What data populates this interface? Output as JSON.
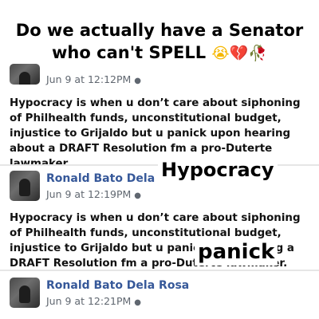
{
  "headline": {
    "line1": "Do we actually have a Senator",
    "line2": "who can't SPELL",
    "emojis": [
      "😭",
      "💔",
      "🥀"
    ]
  },
  "posts": [
    {
      "timestamp": "Jun 9 at 12:12PM",
      "text": "Hypocracy is when u don’t care about siphoning of Philhealth funds, unconstitutional budget, injustice to Grijaldo but u panick upon hearing about a DRAFT Resolution fm a pro-Duterte lawmaker."
    },
    {
      "author": "Ronald Bato Dela Rosa",
      "timestamp": "Jun 9 at 12:19PM",
      "text": "Hypocracy is when u don’t care about siphoning of Philhealth funds, unconstitutional budget, injustice to Grijaldo but u panic upon hearing a DRAFT Resolution fm a pro-Duterte lawmaker."
    },
    {
      "author": "Ronald Bato Dela Rosa",
      "timestamp": "Jun 9 at 12:21PM"
    }
  ],
  "callouts": {
    "word1": "Hypocracy",
    "word2": "panick"
  },
  "icons": {
    "globe": "globe-icon"
  }
}
